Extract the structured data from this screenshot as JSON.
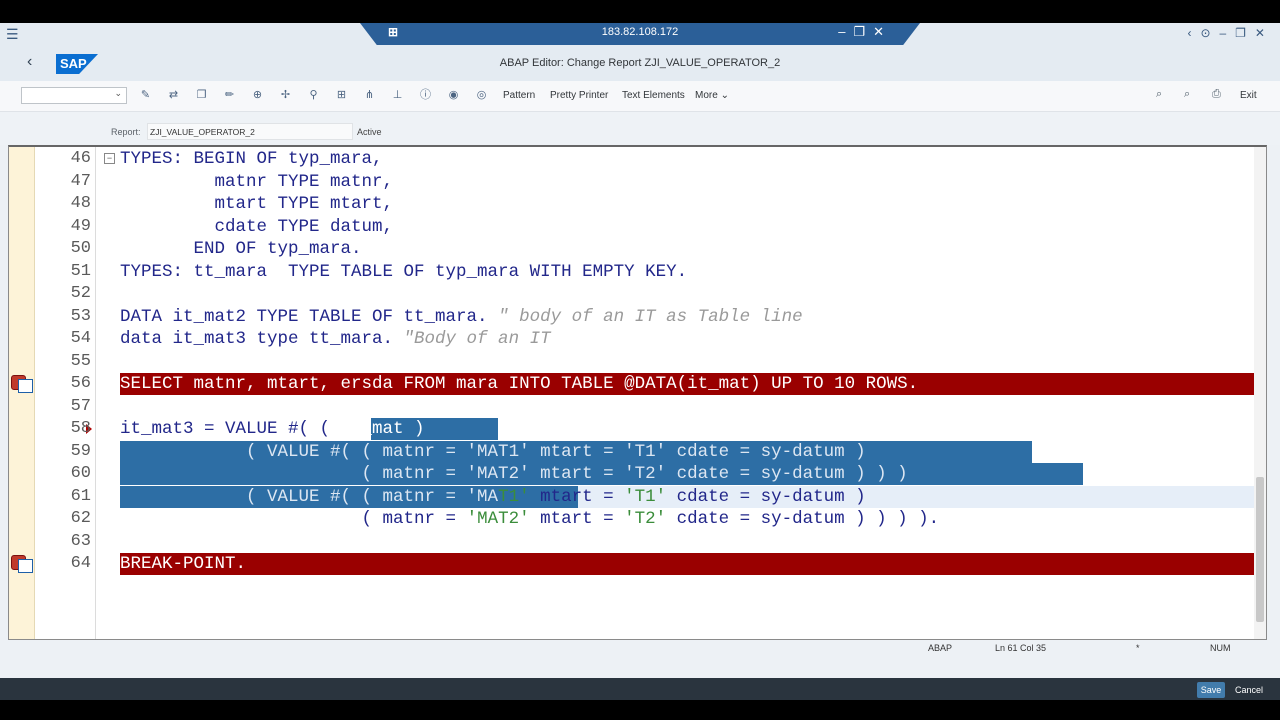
{
  "remote": {
    "ip": "183.82.108.172"
  },
  "shell": {
    "title": "ABAP Editor: Change Report ZJI_VALUE_OPERATOR_2",
    "logo": "SAP"
  },
  "toolbar": {
    "pattern_label": "Pattern",
    "pretty_printer_label": "Pretty Printer",
    "text_elements_label": "Text Elements",
    "more_label": "More",
    "exit_label": "Exit"
  },
  "report": {
    "label": "Report:",
    "name": "ZJI_VALUE_OPERATOR_2",
    "status": "Active"
  },
  "code": {
    "lines": [
      {
        "num": "46",
        "text": "TYPES: BEGIN OF typ_mara,"
      },
      {
        "num": "47",
        "text": "         matnr TYPE matnr,"
      },
      {
        "num": "48",
        "text": "         mtart TYPE mtart,"
      },
      {
        "num": "49",
        "text": "         cdate TYPE datum,"
      },
      {
        "num": "50",
        "text": "       END OF typ_mara."
      },
      {
        "num": "51",
        "text": "TYPES: tt_mara  TYPE TABLE OF typ_mara WITH EMPTY KEY."
      },
      {
        "num": "52",
        "text": ""
      },
      {
        "num": "53",
        "text": "DATA it_mat2 TYPE TABLE OF tt_mara. \" body of an IT as Table line"
      },
      {
        "num": "54",
        "text": "data it_mat3 type tt_mara. \"Body of an IT"
      },
      {
        "num": "55",
        "text": ""
      },
      {
        "num": "56",
        "text": "SELECT matnr, mtart, ersda FROM mara INTO TABLE @DATA(it_mat) UP TO 10 ROWS."
      },
      {
        "num": "57",
        "text": ""
      },
      {
        "num": "58",
        "text": "it_mat3 = VALUE #( ( it_mat )"
      },
      {
        "num": "59",
        "text": "            ( VALUE #( ( matnr = 'MAT1' mtart = 'T1' cdate = sy-datum )"
      },
      {
        "num": "60",
        "text": "                       ( matnr = 'MAT2' mtart = 'T2' cdate = sy-datum ) ) )"
      },
      {
        "num": "61",
        "text": "            ( VALUE #( ( matnr = 'MAT1' mtart = 'T1' cdate = sy-datum )"
      },
      {
        "num": "62",
        "text": "                       ( matnr = 'MAT2' mtart = 'T2' cdate = sy-datum ) ) ) )."
      },
      {
        "num": "63",
        "text": ""
      },
      {
        "num": "64",
        "text": "BREAK-POINT."
      }
    ]
  },
  "status": {
    "language": "ABAP",
    "position": "Ln 61 Col 35",
    "modified": "*",
    "num": "NUM"
  },
  "footer": {
    "save_label": "Save",
    "cancel_label": "Cancel"
  },
  "colors": {
    "breakpoint_line": "#9a0000",
    "selection": "#2d6ea5",
    "keyword": "#22278a",
    "string": "#3b8d3b",
    "comment": "#9a9a9a"
  }
}
